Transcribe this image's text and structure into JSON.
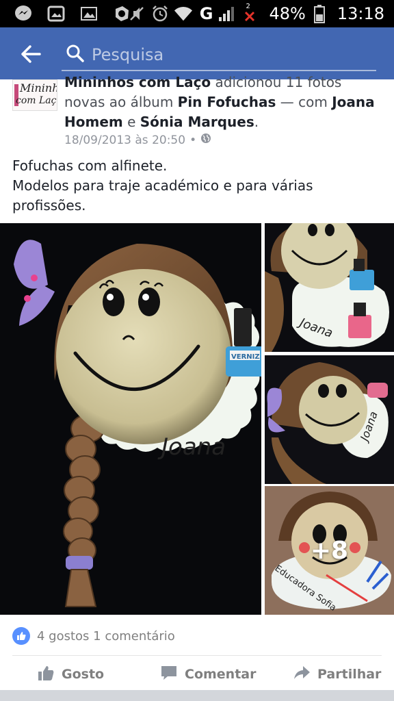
{
  "status_bar": {
    "battery_percent": "48%",
    "time": "13:18",
    "network": "G",
    "sim_slot": "2",
    "icons": [
      "messenger-icon",
      "gallery-icon",
      "image-icon",
      "app-icon",
      "mute-icon",
      "alarm-icon",
      "wifi-icon",
      "signal-icon",
      "no-signal-icon",
      "battery-icon"
    ]
  },
  "search": {
    "placeholder": "Pesquisa"
  },
  "post": {
    "author": "Mininhos com Laço",
    "action": " adicionou 11 fotos novas ao álbum ",
    "album": "Pin Fofuchas",
    "with": " — com ",
    "tag1": "Joana Homem",
    "and": " e ",
    "tag2": "Sónia Marques",
    "period": ".",
    "timestamp": "18/09/2013 às 20:50",
    "separator": "•",
    "privacy_icon": "globe-icon",
    "text_lines": [
      "Fofuchas com alfinete.",
      "Modelos para traje académico e para várias",
      "profissões."
    ],
    "avatar_logo_line1": "Mininh",
    "avatar_logo_line2": "com Laço"
  },
  "photos": {
    "main_label": "Joana",
    "thumb1_label": "Joana",
    "thumb2_label": "Joana",
    "thumb3_label": "Educadora Sofia",
    "nail_label": "VERNIZ",
    "more_count": "+8"
  },
  "reactions": {
    "summary": "4 gostos 1 comentário"
  },
  "actions": {
    "like": "Gosto",
    "comment": "Comentar",
    "share": "Partilhar"
  },
  "colors": {
    "facebook_blue": "#4267b2",
    "like_blue": "#5890ff",
    "status_bar": "#000000"
  }
}
